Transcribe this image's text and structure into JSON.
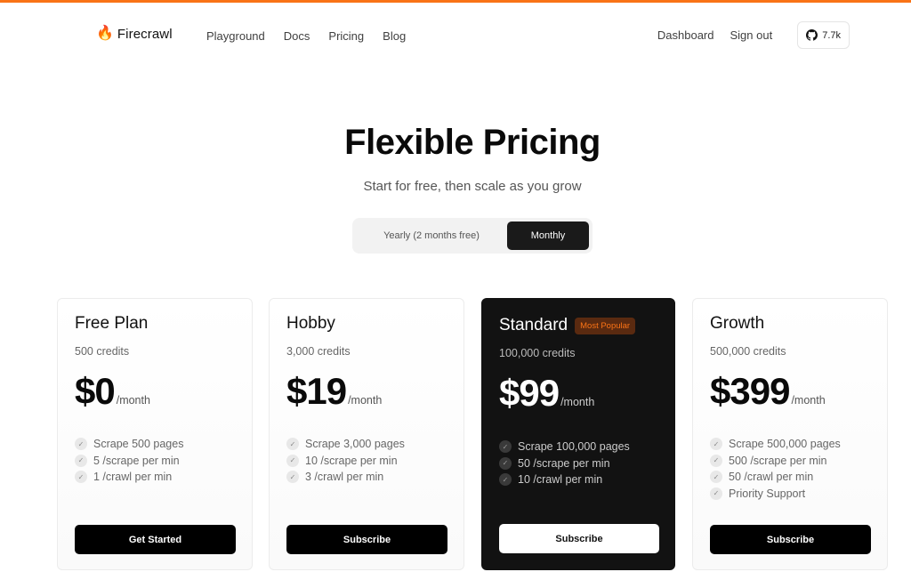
{
  "brand": {
    "name": "Firecrawl",
    "icon": "fire-emoji",
    "accent": "#f97316"
  },
  "nav": {
    "links": [
      "Playground",
      "Docs",
      "Pricing",
      "Blog"
    ],
    "dashboard": "Dashboard",
    "sign_out": "Sign out",
    "github_stars": "7.7k"
  },
  "hero": {
    "title": "Flexible Pricing",
    "subtitle": "Start for free, then scale as you grow"
  },
  "billing_toggle": {
    "yearly": "Yearly (2 months free)",
    "monthly": "Monthly",
    "selected": "Monthly"
  },
  "plans": [
    {
      "name": "Free Plan",
      "credits": "500 credits",
      "price": "$0",
      "period": "/month",
      "features": [
        "Scrape 500 pages",
        "5 /scrape per min",
        "1 /crawl per min"
      ],
      "cta": "Get Started"
    },
    {
      "name": "Hobby",
      "credits": "3,000 credits",
      "price": "$19",
      "period": "/month",
      "features": [
        "Scrape 3,000 pages",
        "10 /scrape per min",
        "3 /crawl per min"
      ],
      "cta": "Subscribe"
    },
    {
      "name": "Standard",
      "badge": "Most Popular",
      "credits": "100,000 credits",
      "price": "$99",
      "period": "/month",
      "features": [
        "Scrape 100,000 pages",
        "50 /scrape per min",
        "10 /crawl per min"
      ],
      "cta": "Subscribe"
    },
    {
      "name": "Growth",
      "credits": "500,000 credits",
      "price": "$399",
      "period": "/month",
      "features": [
        "Scrape 500,000 pages",
        "500 /scrape per min",
        "50 /crawl per min",
        "Priority Support"
      ],
      "cta": "Subscribe"
    }
  ]
}
